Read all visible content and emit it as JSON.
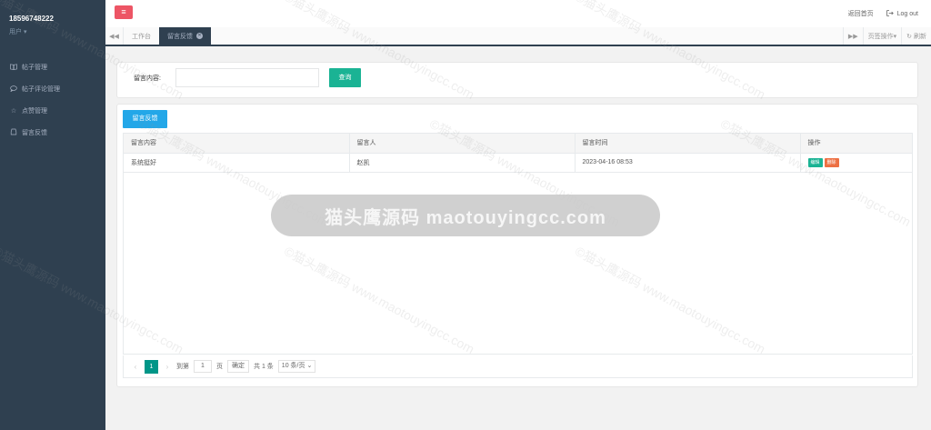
{
  "sidebar": {
    "username": "18596748222",
    "role": "用户",
    "items": [
      {
        "icon": "book-icon",
        "label": "帖子管理"
      },
      {
        "icon": "comment-icon",
        "label": "帖子评论管理"
      },
      {
        "icon": "star-icon",
        "label": "点赞管理"
      },
      {
        "icon": "feedback-icon",
        "label": "留言反馈"
      }
    ]
  },
  "topbar": {
    "menu_icon": "hamburger-icon",
    "home_link": "返回首页",
    "logout": "Log out"
  },
  "tabs": {
    "items": [
      {
        "label": "工作台",
        "active": false
      },
      {
        "label": "留言反馈",
        "active": true
      }
    ],
    "page_ops": "页签操作",
    "refresh": "刷新"
  },
  "search": {
    "label": "留言内容:",
    "input_value": "",
    "button": "查询"
  },
  "table": {
    "add_button": "留言反馈",
    "columns": [
      "留言内容",
      "留言人",
      "留言时间",
      "操作"
    ],
    "rows": [
      {
        "content": "系统挺好",
        "user": "赵凯",
        "time": "2023-04-16 08:53",
        "edit": "编辑",
        "delete": "删除"
      }
    ]
  },
  "pager": {
    "current_page": "1",
    "goto_label": "到第",
    "goto_value": "1",
    "page_unit": "页",
    "confirm": "确定",
    "total": "共 1 条",
    "page_size": "10 条/页"
  },
  "overlay": {
    "text": "猫头鹰源码 maotouyingcc.com"
  },
  "watermark": {
    "text": "©猫头鹰源码 www.maotouyingcc.com"
  }
}
